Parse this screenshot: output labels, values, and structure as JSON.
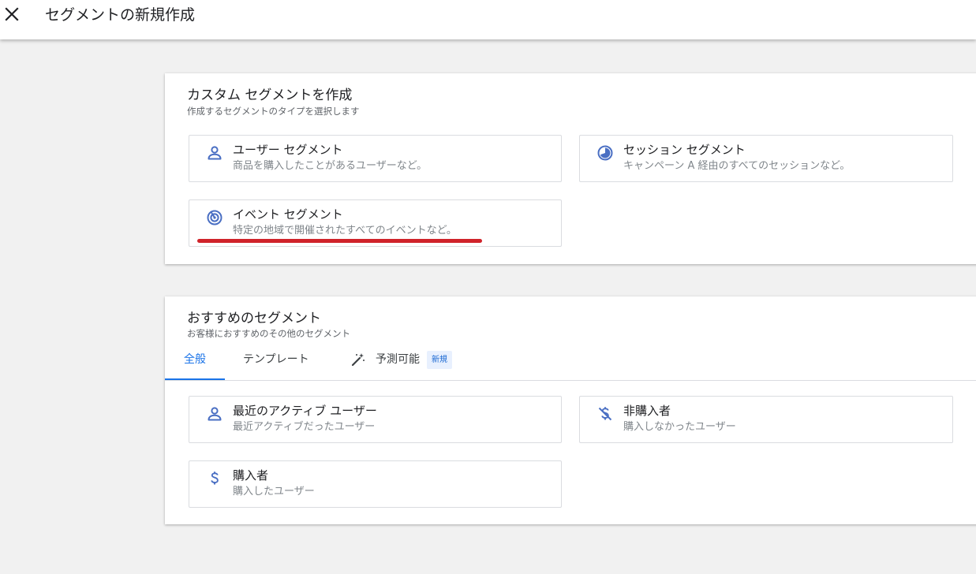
{
  "header": {
    "title": "セグメントの新規作成"
  },
  "custom": {
    "title": "カスタム セグメントを作成",
    "subtitle": "作成するセグメントのタイプを選択します",
    "cards": [
      {
        "title": "ユーザー セグメント",
        "desc": "商品を購入したことがあるユーザーなど。",
        "icon": "person-icon"
      },
      {
        "title": "セッション セグメント",
        "desc": "キャンペーン A 経由のすべてのセッションなど。",
        "icon": "session-icon"
      },
      {
        "title": "イベント セグメント",
        "desc": "特定の地域で開催されたすべてのイベントなど。",
        "icon": "event-icon"
      }
    ]
  },
  "recommended": {
    "title": "おすすめのセグメント",
    "subtitle": "お客様におすすめのその他のセグメント",
    "tabs": {
      "general": "全般",
      "templates": "テンプレート",
      "predictive": "予測可能",
      "new_badge": "新規"
    },
    "cards": [
      {
        "title": "最近のアクティブ ユーザー",
        "desc": "最近アクティブだったユーザー",
        "icon": "person-icon"
      },
      {
        "title": "非購入者",
        "desc": "購入しなかったユーザー",
        "icon": "no-money-icon"
      },
      {
        "title": "購入者",
        "desc": "購入したユーザー",
        "icon": "dollar-icon"
      }
    ]
  },
  "colors": {
    "accent": "#1a73e8",
    "icon": "#4a6fc3",
    "highlight_underline": "#d0232a"
  }
}
